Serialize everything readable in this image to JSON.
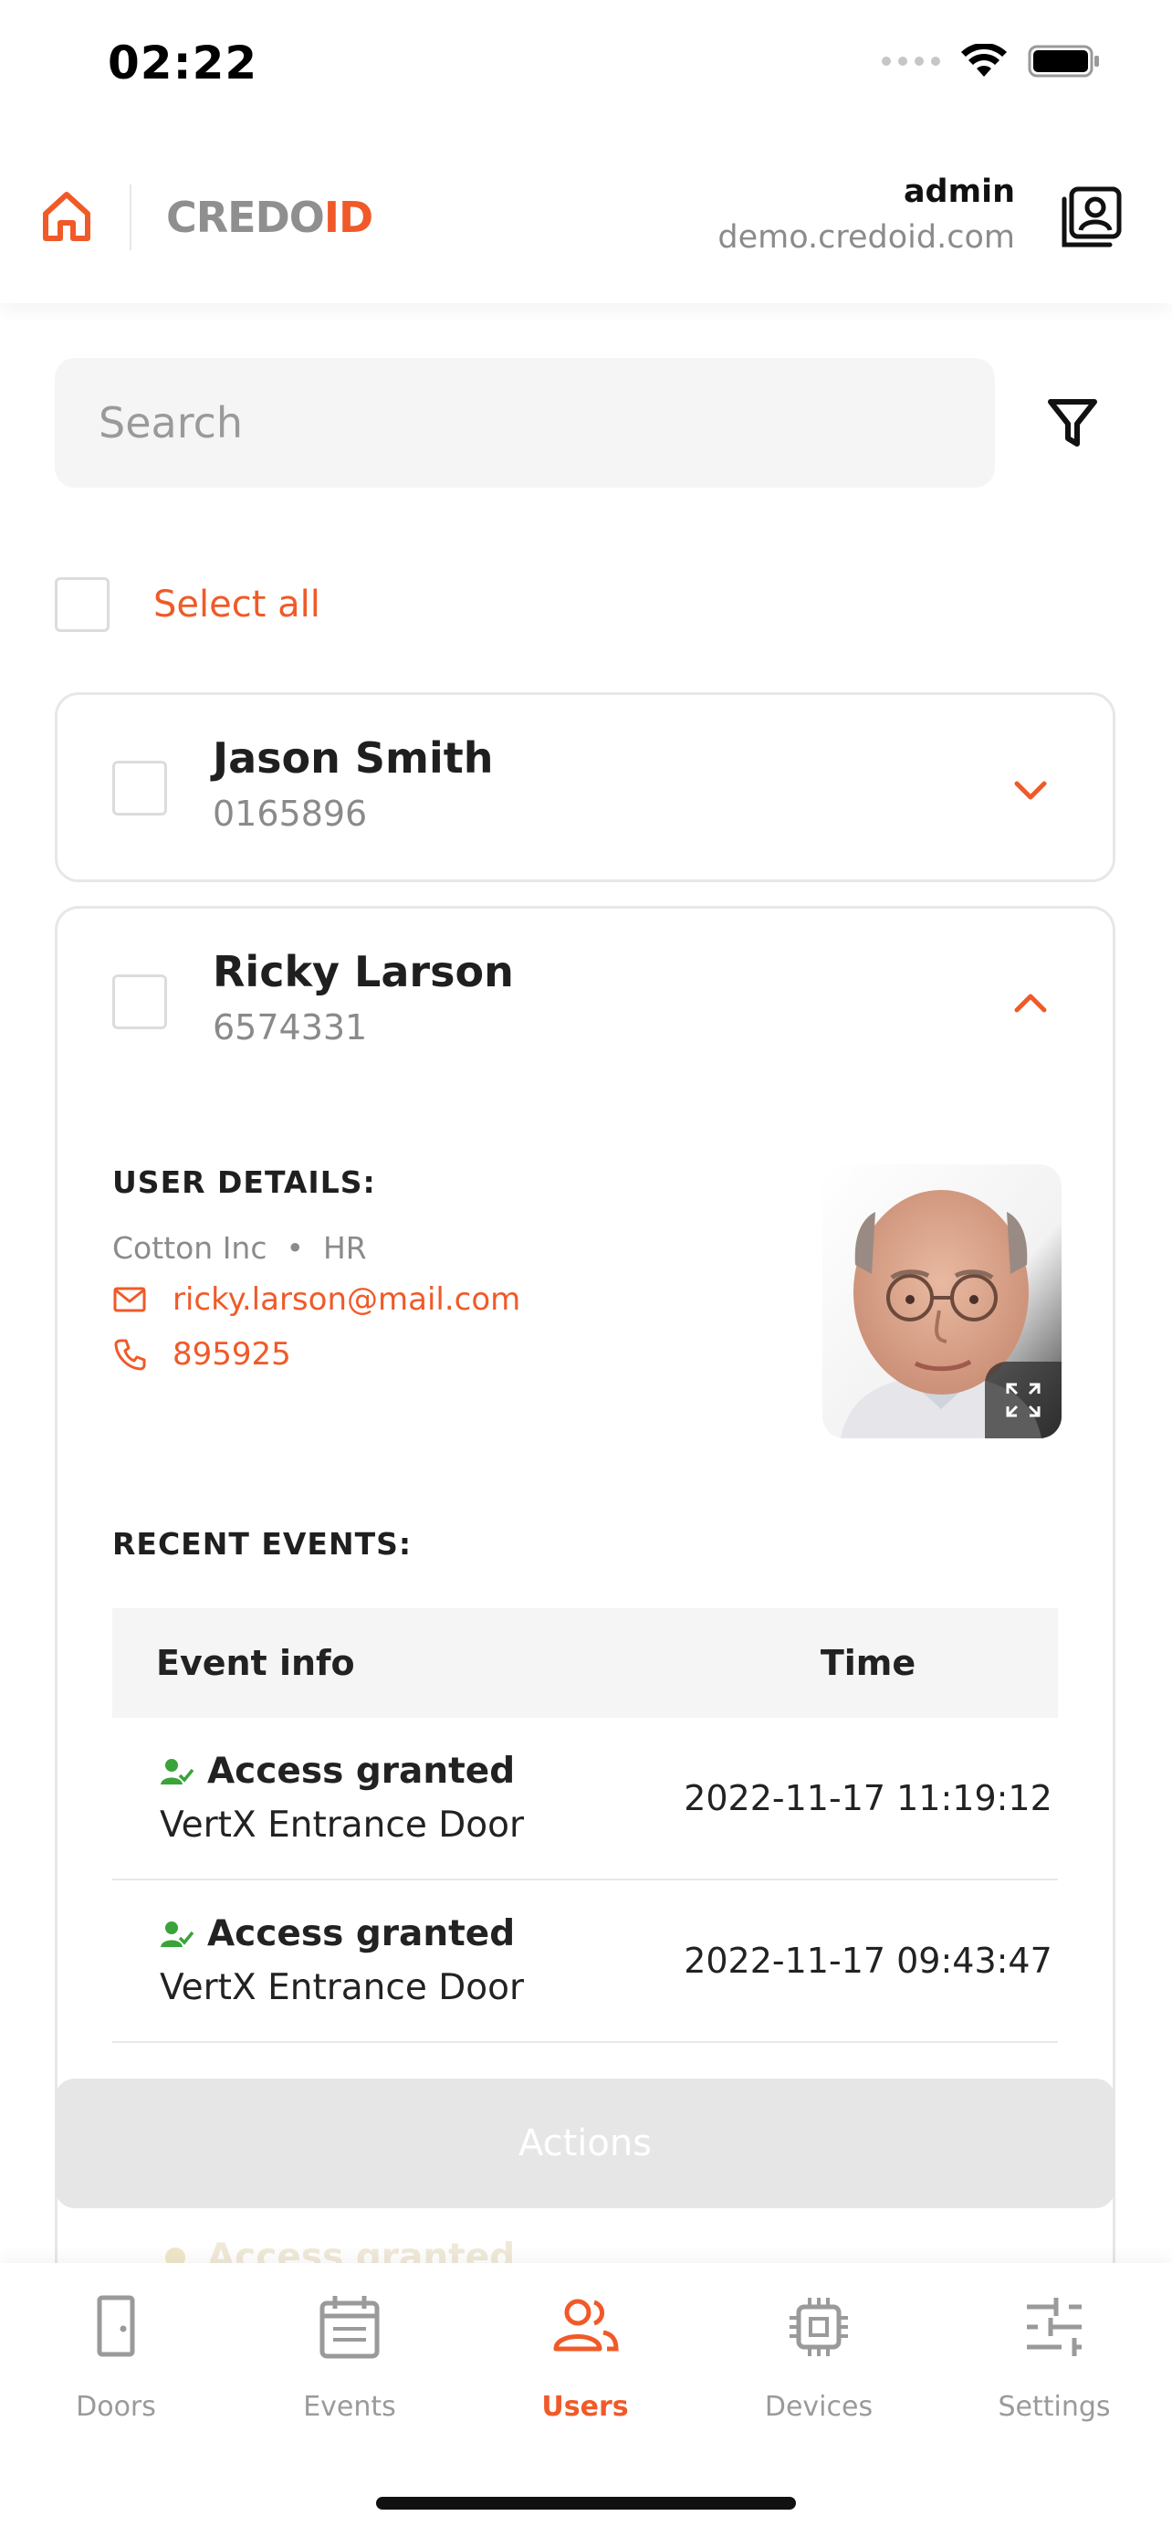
{
  "status_bar": {
    "time": "02:22"
  },
  "header": {
    "logo_left": "CREDO",
    "logo_right": "ID",
    "account_user": "admin",
    "account_host": "demo.credoid.com"
  },
  "search": {
    "placeholder": "Search"
  },
  "select_all_label": "Select all",
  "users": [
    {
      "name": "Jason Smith",
      "id": "0165896",
      "expanded": false
    },
    {
      "name": "Ricky Larson",
      "id": "6574331",
      "expanded": true,
      "details_title": "USER DETAILS:",
      "company": "Cotton Inc",
      "department": "HR",
      "email": "ricky.larson@mail.com",
      "phone": "895925",
      "events_title": "RECENT EVENTS:",
      "events_columns": [
        "Event info",
        "Time"
      ],
      "events": [
        {
          "status": "Access granted",
          "door": "VertX Entrance Door",
          "time": "2022-11-17 11:19:12"
        },
        {
          "status": "Access granted",
          "door": "VertX Entrance Door",
          "time": "2022-11-17 09:43:47"
        },
        {
          "status": "Access granted"
        }
      ]
    }
  ],
  "actions_label": "Actions",
  "tabs": [
    {
      "label": "Doors",
      "icon": "door-icon",
      "active": false
    },
    {
      "label": "Events",
      "icon": "calendar-icon",
      "active": false
    },
    {
      "label": "Users",
      "icon": "users-icon",
      "active": true
    },
    {
      "label": "Devices",
      "icon": "chip-icon",
      "active": false
    },
    {
      "label": "Settings",
      "icon": "sliders-icon",
      "active": false
    }
  ],
  "colors": {
    "accent": "#f05a28",
    "granted": "#3aa33a",
    "muted": "#9a9a9a"
  }
}
